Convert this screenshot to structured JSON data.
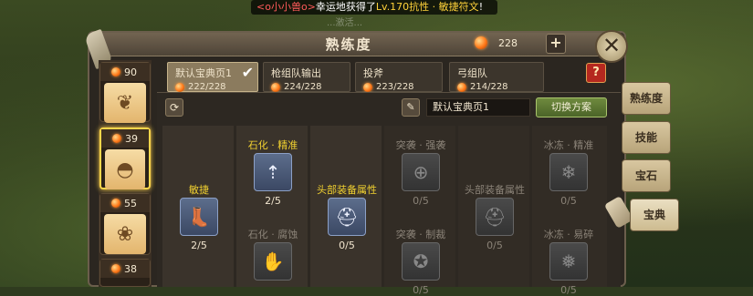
{
  "broadcast": {
    "user": "<o小小兽o>",
    "middle": "幸运地获得了",
    "reward": "Lv.170抗性 · 敏捷符文",
    "end": "!",
    "ghost": "...激活..."
  },
  "header": {
    "title": "熟练度",
    "currency": "228",
    "plus": "+",
    "close": "✕"
  },
  "items": [
    {
      "cost": "90"
    },
    {
      "cost": "39"
    },
    {
      "cost": "55"
    },
    {
      "cost": "38"
    }
  ],
  "pages": [
    {
      "name": "默认宝典页1",
      "progress": "222/228"
    },
    {
      "name": "枪组队输出",
      "progress": "224/228"
    },
    {
      "name": "投斧",
      "progress": "223/228"
    },
    {
      "name": "弓组队",
      "progress": "214/228"
    }
  ],
  "help": "?",
  "toolbar": {
    "page_name": "默认宝典页1",
    "switch": "切换方案"
  },
  "skills": {
    "agility": {
      "label": "敏捷",
      "pts": "2/5"
    },
    "petrify_precise": {
      "label": "石化 · 精准",
      "pts": "2/5"
    },
    "petrify_corrode": {
      "label": "石化 · 腐蚀"
    },
    "head_attr": {
      "label": "头部装备属性",
      "pts": "0/5"
    },
    "assault_strong": {
      "label": "突袭 · 强袭",
      "pts": "0/5"
    },
    "assault_control": {
      "label": "突袭 · 制裁",
      "pts": "0/5"
    },
    "head_attr2": {
      "label": "头部装备属性",
      "pts": "0/5"
    },
    "freeze_precise": {
      "label": "冰冻 · 精准",
      "pts": "0/5"
    },
    "freeze_fragile": {
      "label": "冰冻 · 易碎",
      "pts": "0/5"
    }
  },
  "side_tabs": [
    "熟练度",
    "技能",
    "宝石",
    "宝典"
  ]
}
